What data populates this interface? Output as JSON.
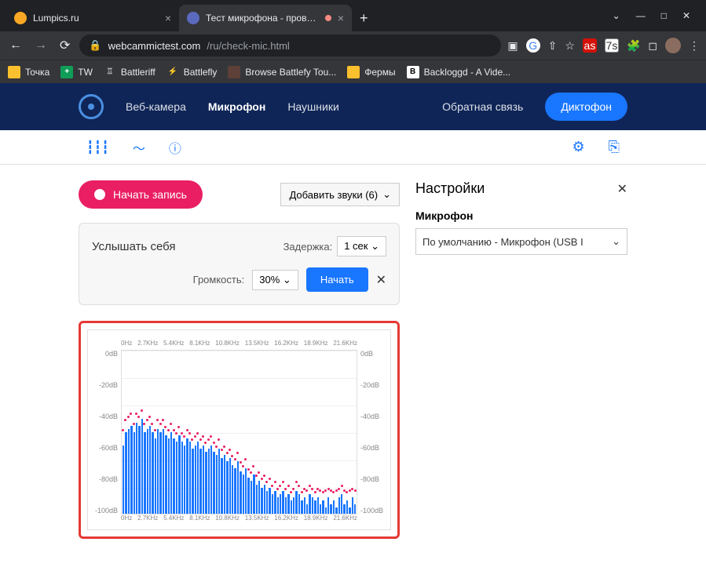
{
  "browser": {
    "tabs": [
      {
        "title": "Lumpics.ru",
        "favicon_color": "#f9a825"
      },
      {
        "title": "Тест микрофона - проверка",
        "favicon_color": "#5b6abf",
        "recording": true
      }
    ],
    "url_host": "webcammictest.com",
    "url_path": "/ru/check-mic.html",
    "bookmarks": [
      {
        "label": "Точка",
        "color": "#fbc02d"
      },
      {
        "label": "TW",
        "color": "#0f9d58"
      },
      {
        "label": "Battleriff",
        "color": "#424242"
      },
      {
        "label": "Battlefly",
        "color": "#d32f2f"
      },
      {
        "label": "Browse Battlefy Tou...",
        "color": "#5d4037"
      },
      {
        "label": "Фермы",
        "color": "#fbc02d"
      },
      {
        "label": "Backloggd - A Vide...",
        "color": "#fff"
      }
    ]
  },
  "nav": {
    "webcam": "Веб-камера",
    "mic": "Микрофон",
    "headphones": "Наушники",
    "feedback": "Обратная связь",
    "recorder": "Диктофон"
  },
  "controls": {
    "record": "Начать запись",
    "add_sounds": "Добавить звуки (6)",
    "hear_yourself": "Услышать себя",
    "delay_label": "Задержка:",
    "delay_value": "1 сек",
    "volume_label": "Громкость:",
    "volume_value": "30%",
    "start": "Начать"
  },
  "settings": {
    "title": "Настройки",
    "mic_label": "Микрофон",
    "device": "По умолчанию - Микрофон (USB I"
  },
  "chart_data": {
    "type": "bar",
    "xlabel_ticks": [
      "0Hz",
      "2.7KHz",
      "5.4KHz",
      "8.1KHz",
      "10.8KHz",
      "13.5KHz",
      "16.2KHz",
      "18.9KHz",
      "21.6KHz"
    ],
    "ylabel_ticks": [
      "0dB",
      "-20dB",
      "-40dB",
      "-60dB",
      "-80dB",
      "-100dB"
    ],
    "ylim": [
      -100,
      0
    ],
    "values": [
      -58,
      -50,
      -48,
      -46,
      -50,
      -44,
      -46,
      -42,
      -50,
      -48,
      -46,
      -50,
      -54,
      -48,
      -50,
      -48,
      -52,
      -54,
      -50,
      -54,
      -56,
      -52,
      -56,
      -58,
      -54,
      -56,
      -60,
      -58,
      -56,
      -60,
      -58,
      -62,
      -60,
      -58,
      -62,
      -64,
      -60,
      -66,
      -64,
      -68,
      -66,
      -70,
      -72,
      -68,
      -74,
      -76,
      -72,
      -78,
      -80,
      -76,
      -82,
      -80,
      -84,
      -82,
      -86,
      -84,
      -88,
      -86,
      -90,
      -88,
      -86,
      -90,
      -88,
      -92,
      -90,
      -86,
      -88,
      -92,
      -90,
      -94,
      -88,
      -90,
      -92,
      -90,
      -94,
      -92,
      -96,
      -90,
      -94,
      -92,
      -96,
      -90,
      -88,
      -94,
      -92,
      -96,
      -90,
      -94
    ],
    "peaks": [
      -48,
      -42,
      -40,
      -38,
      -44,
      -38,
      -40,
      -36,
      -44,
      -42,
      -40,
      -44,
      -48,
      -42,
      -44,
      -42,
      -46,
      -48,
      -44,
      -48,
      -50,
      -46,
      -50,
      -52,
      -48,
      -50,
      -54,
      -52,
      -50,
      -54,
      -52,
      -56,
      -54,
      -52,
      -56,
      -58,
      -54,
      -60,
      -58,
      -62,
      -60,
      -64,
      -66,
      -62,
      -68,
      -70,
      -66,
      -72,
      -74,
      -70,
      -76,
      -74,
      -78,
      -76,
      -80,
      -78,
      -82,
      -80,
      -84,
      -82,
      -80,
      -84,
      -82,
      -86,
      -84,
      -80,
      -82,
      -86,
      -84,
      -85,
      -82,
      -84,
      -86,
      -84,
      -85,
      -86,
      -85,
      -84,
      -85,
      -86,
      -85,
      -84,
      -82,
      -85,
      -86,
      -85,
      -84,
      -85
    ]
  }
}
